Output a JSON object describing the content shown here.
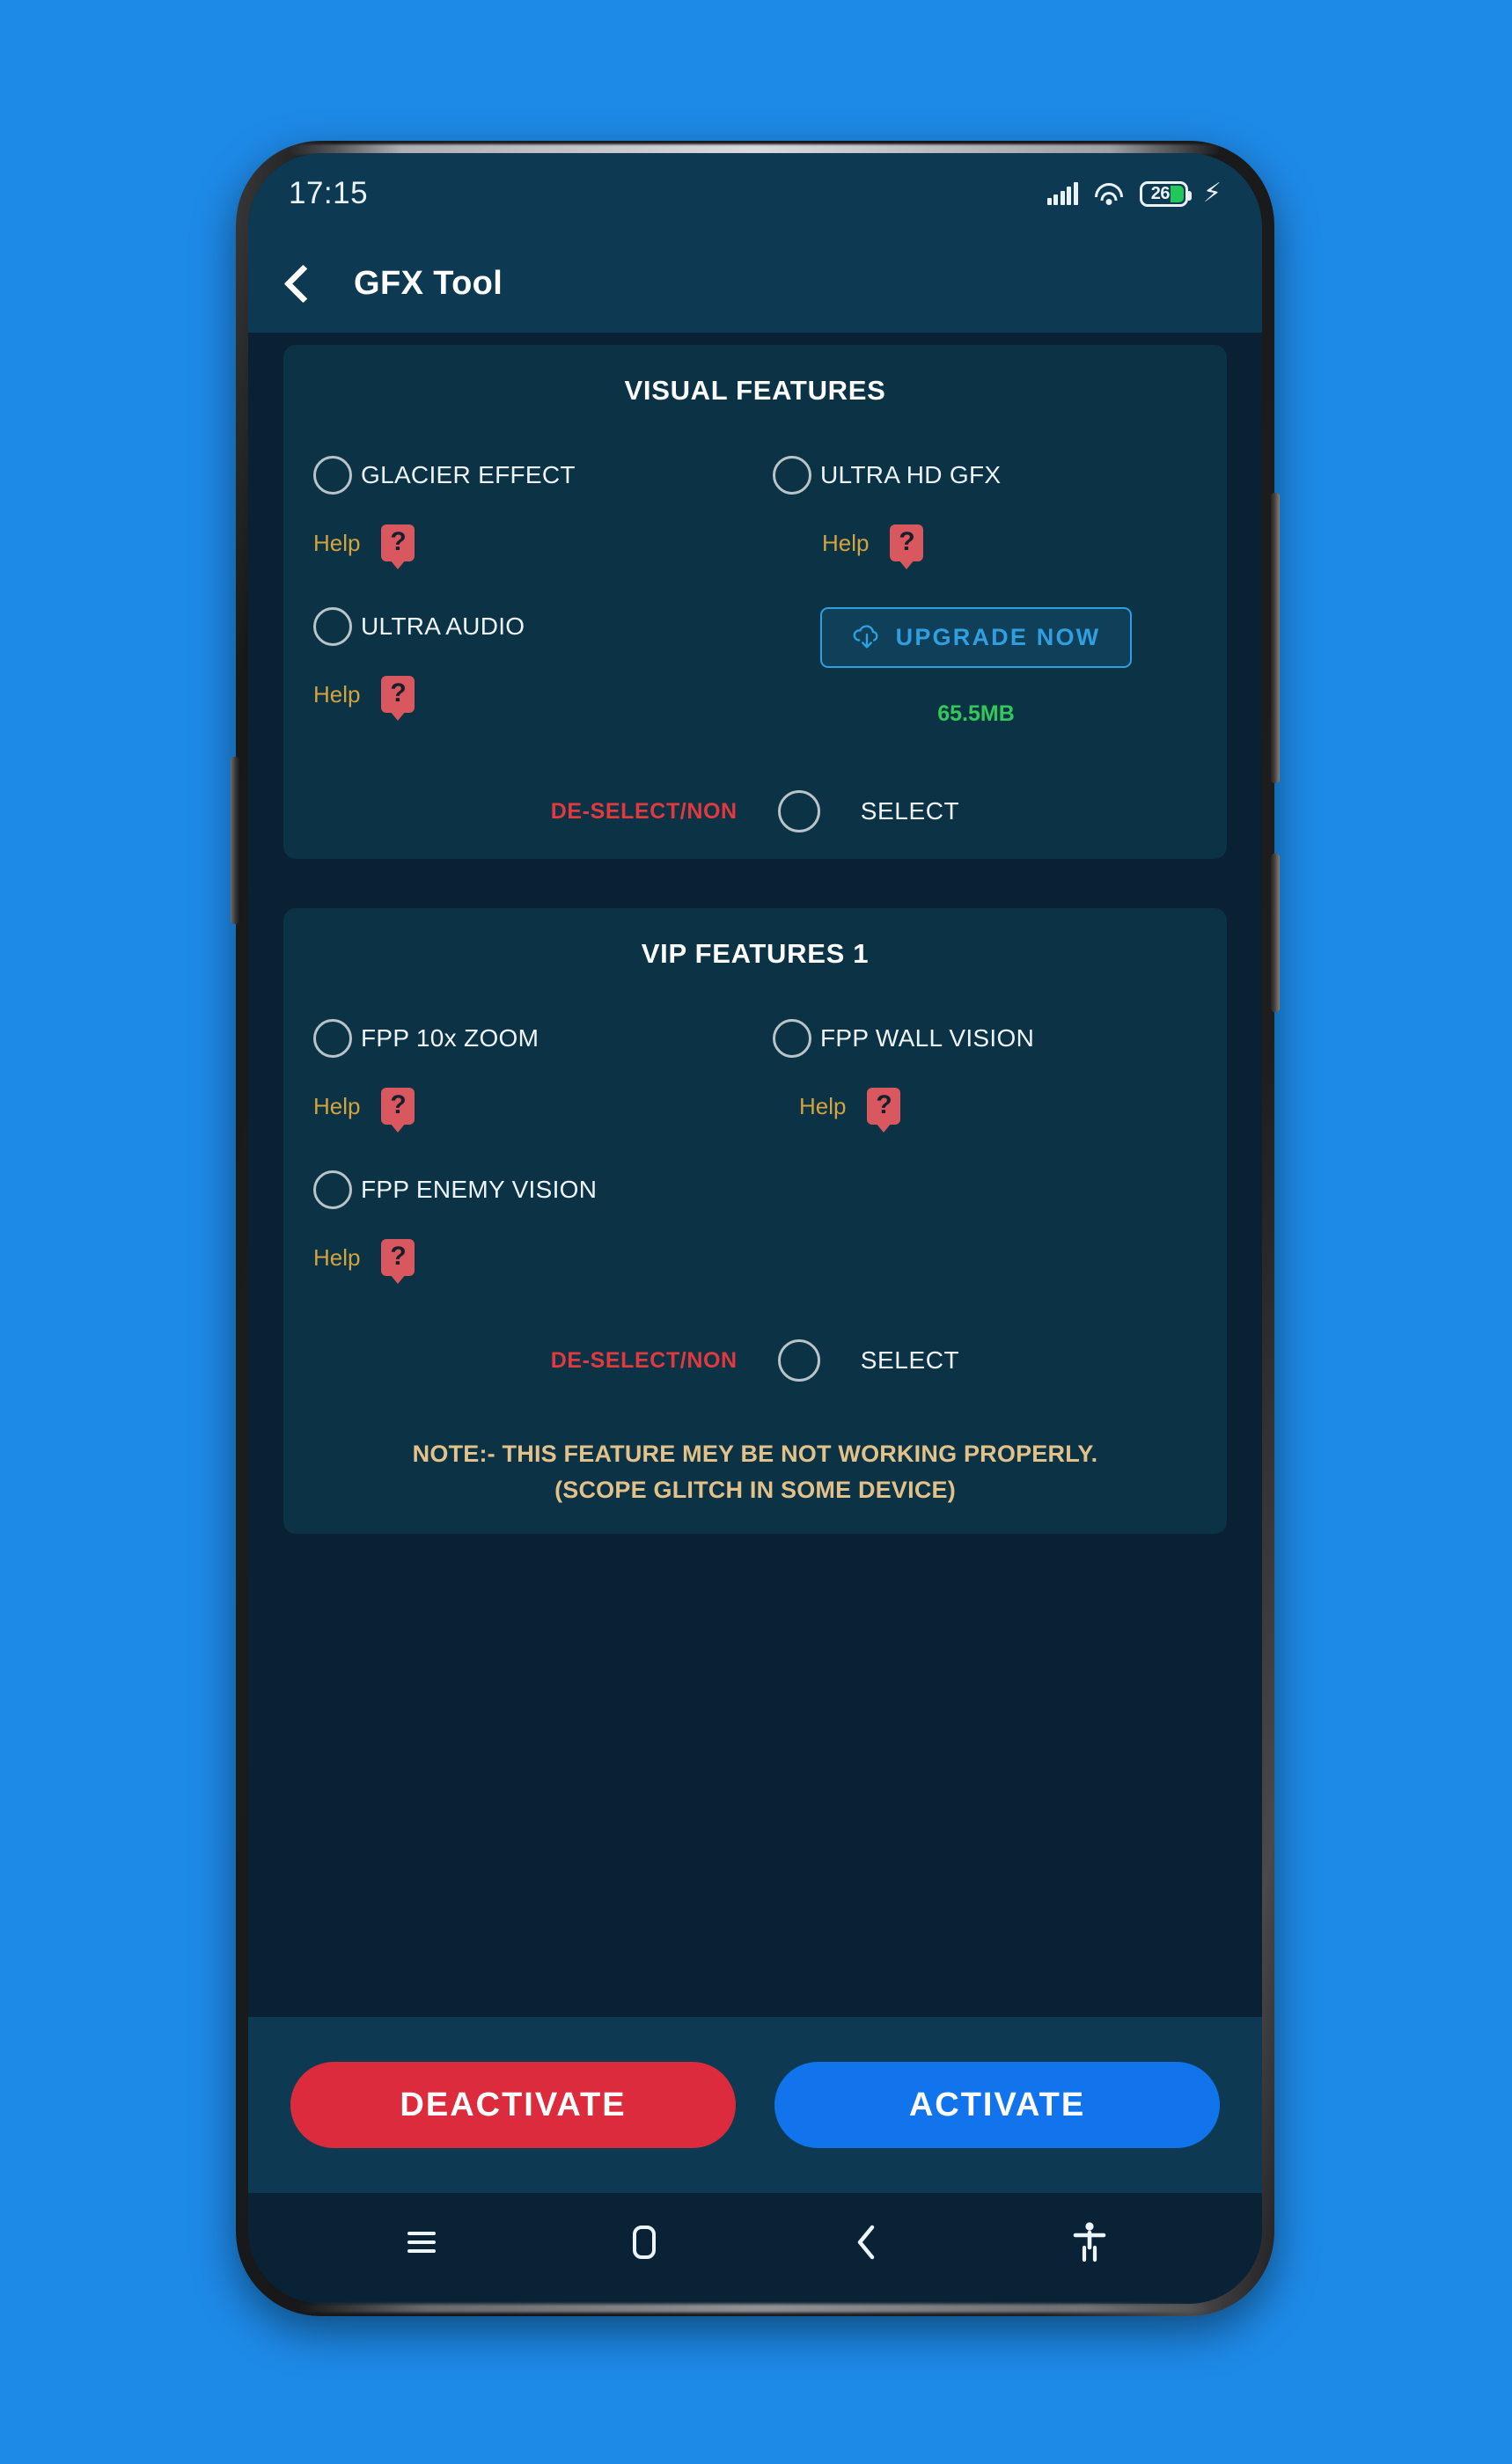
{
  "status_bar": {
    "time": "17:15",
    "signal_icon": "signal-bars-icon",
    "wifi_icon": "wifi-icon",
    "battery_level": "26",
    "charging_icon": "lightning-bolt-icon"
  },
  "app_bar": {
    "back_icon": "back-chevron-icon",
    "title": "GFX Tool"
  },
  "cards": [
    {
      "title": "VISUAL FEATURES",
      "options": [
        {
          "label": "GLACIER EFFECT",
          "help_label": "Help",
          "help_icon": "question-mark-icon",
          "checked": false
        },
        {
          "label": "ULTRA HD GFX",
          "help_label": "Help",
          "help_icon": "question-mark-icon",
          "checked": false
        },
        {
          "label": "ULTRA AUDIO",
          "help_label": "Help",
          "help_icon": "question-mark-icon",
          "checked": false
        }
      ],
      "upgrade": {
        "label": "UPGRADE NOW",
        "icon": "cloud-download-icon",
        "size": "65.5MB"
      },
      "select_row": {
        "deselect_label": "DE-SELECT/NON",
        "select_label": "SELECT",
        "checked": false
      }
    },
    {
      "title": "VIP FEATURES 1",
      "options": [
        {
          "label": "FPP 10x ZOOM",
          "help_label": "Help",
          "help_icon": "question-mark-icon",
          "checked": false
        },
        {
          "label": "FPP WALL VISION",
          "help_label": "Help",
          "help_icon": "question-mark-icon",
          "checked": false
        },
        {
          "label": "FPP ENEMY VISION",
          "help_label": "Help",
          "help_icon": "question-mark-icon",
          "checked": false
        }
      ],
      "select_row": {
        "deselect_label": "DE-SELECT/NON",
        "select_label": "SELECT",
        "checked": false
      },
      "note_line_1": "NOTE:- THIS FEATURE MEY BE NOT WORKING PROPERLY.",
      "note_line_2": "(SCOPE GLITCH IN SOME DEVICE)"
    }
  ],
  "action_bar": {
    "deactivate_label": "DEACTIVATE",
    "activate_label": "ACTIVATE"
  },
  "nav_bar": {
    "menu_icon": "hamburger-menu-icon",
    "home_icon": "home-square-icon",
    "back_icon": "back-chevron-icon",
    "accessibility_icon": "accessibility-icon"
  },
  "colors": {
    "page_background": "#1e8ae8",
    "screen_background": "#0a2033",
    "card_background": "#0c3246",
    "bar_background": "#0d3a52",
    "accent_blue": "#2f9fe0",
    "activate_blue": "#1174ec",
    "deactivate_red": "#dc2b3c",
    "help_gold": "#d2a33f",
    "help_badge_red": "#d9575e",
    "deselect_red": "#e2393f",
    "size_green": "#34c759",
    "note_tan": "#e3c289",
    "battery_green": "#22c75b"
  }
}
